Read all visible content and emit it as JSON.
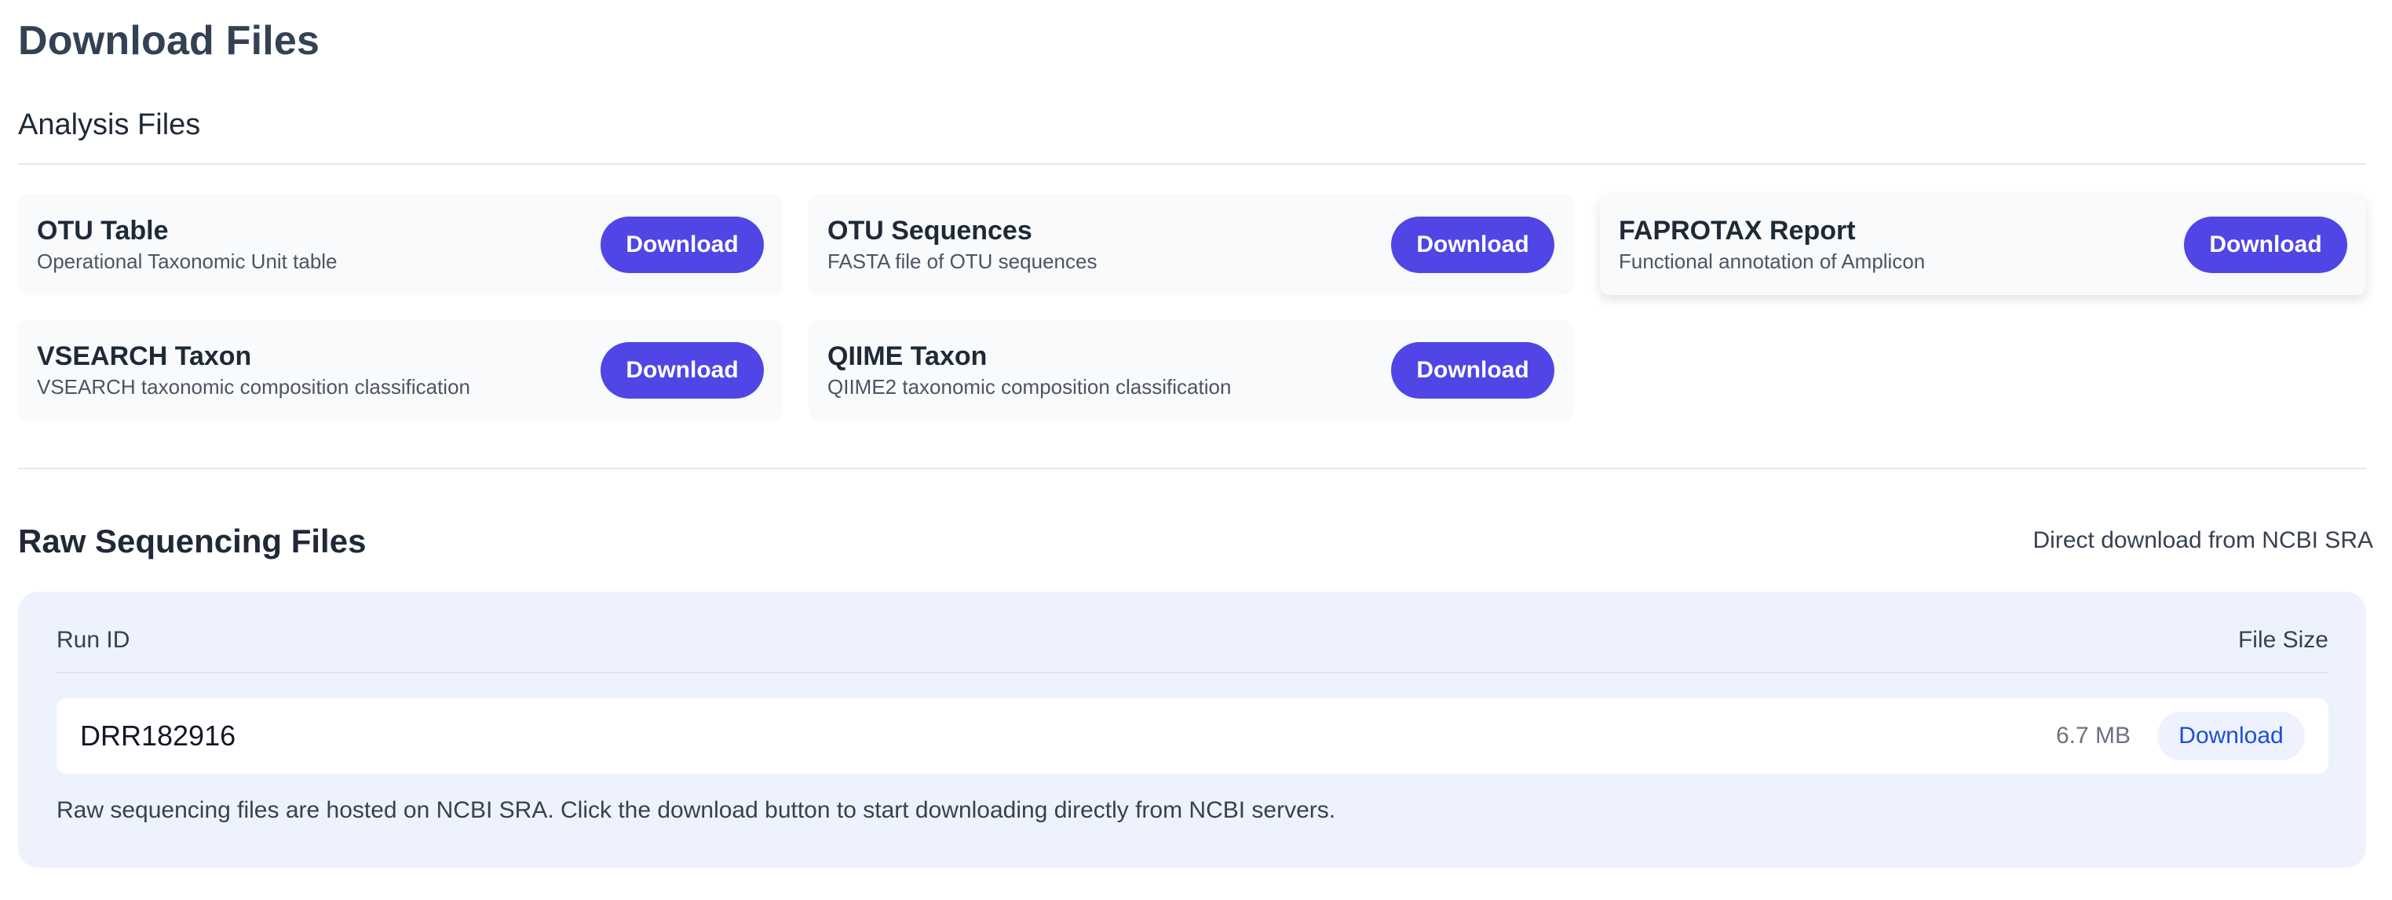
{
  "page": {
    "title": "Download Files"
  },
  "analysis": {
    "section_title": "Analysis Files",
    "download_label": "Download",
    "files": [
      {
        "title": "OTU Table",
        "description": "Operational Taxonomic Unit table"
      },
      {
        "title": "OTU Sequences",
        "description": "FASTA file of OTU sequences"
      },
      {
        "title": "FAPROTAX Report",
        "description": "Functional annotation of Amplicon"
      },
      {
        "title": "VSEARCH Taxon",
        "description": "VSEARCH taxonomic composition classification"
      },
      {
        "title": "QIIME Taxon",
        "description": "QIIME2 taxonomic composition classification"
      }
    ]
  },
  "raw": {
    "title": "Raw Sequencing Files",
    "source_note": "Direct download from NCBI SRA",
    "columns": {
      "run_id": "Run ID",
      "file_size": "File Size"
    },
    "rows": [
      {
        "run_id": "DRR182916",
        "file_size": "6.7 MB",
        "action": "Download"
      }
    ],
    "footer": "Raw sequencing files are hosted on NCBI SRA. Click the download button to start downloading directly from NCBI servers."
  },
  "colors": {
    "primary_button": "#4f46e5",
    "soft_button_text": "#1d4ed8",
    "panel_background": "#eef2fd"
  }
}
